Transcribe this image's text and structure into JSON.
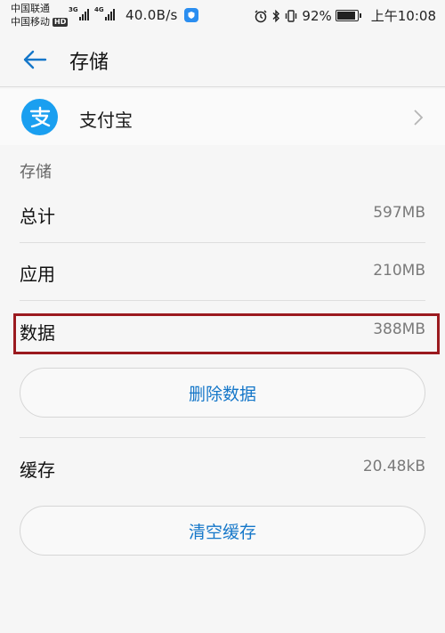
{
  "status_bar": {
    "carrier_1": "中国联通",
    "carrier_2": "中国移动",
    "hd_badge": "HD",
    "sim1_tag": "3G",
    "sim2_tag": "4G",
    "net_speed": "40.0B/s",
    "battery_percent": "92%",
    "battery_level": 0.92,
    "time": "上午10:08",
    "icons": [
      "alarm-icon",
      "bluetooth-icon",
      "vibrate-icon",
      "battery-icon"
    ]
  },
  "header": {
    "back_icon": "arrow-left-icon",
    "title": "存储"
  },
  "app": {
    "name": "支付宝",
    "logo_glyph": "支"
  },
  "storage": {
    "section_title": "存储",
    "rows": [
      {
        "label": "总计",
        "value": "597MB"
      },
      {
        "label": "应用",
        "value": "210MB"
      },
      {
        "label": "数据",
        "value": "388MB"
      }
    ],
    "delete_data_button": "删除数据",
    "cache_label": "缓存",
    "cache_value": "20.48kB",
    "clear_cache_button": "清空缓存"
  },
  "colors": {
    "accent": "#1577c9",
    "alipay_blue": "#1a9ff0",
    "highlight_red": "#9b1a1f"
  }
}
